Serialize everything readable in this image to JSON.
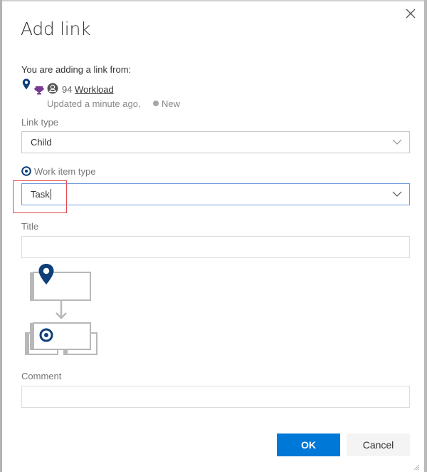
{
  "dialog": {
    "title": "Add link",
    "close_icon": "close-icon"
  },
  "source": {
    "intro": "You are adding a link from:",
    "icons": [
      "map-pin-icon",
      "trophy-icon",
      "avatar-icon"
    ],
    "id": "94",
    "name": "Workload",
    "updated": "Updated a minute ago,",
    "state": "New",
    "state_color": "#a6a6a6"
  },
  "link_type": {
    "label": "Link type",
    "value": "Child"
  },
  "work_item_type": {
    "label": "Work item type",
    "icon": "target-icon",
    "value": "Task"
  },
  "title_field": {
    "label": "Title",
    "value": ""
  },
  "comment_field": {
    "label": "Comment",
    "value": ""
  },
  "buttons": {
    "ok": "OK",
    "cancel": "Cancel"
  },
  "colors": {
    "accent": "#0078d7",
    "icon_blue": "#0e3f79",
    "trophy_purple": "#773b93",
    "highlight_red": "#e5484d"
  }
}
